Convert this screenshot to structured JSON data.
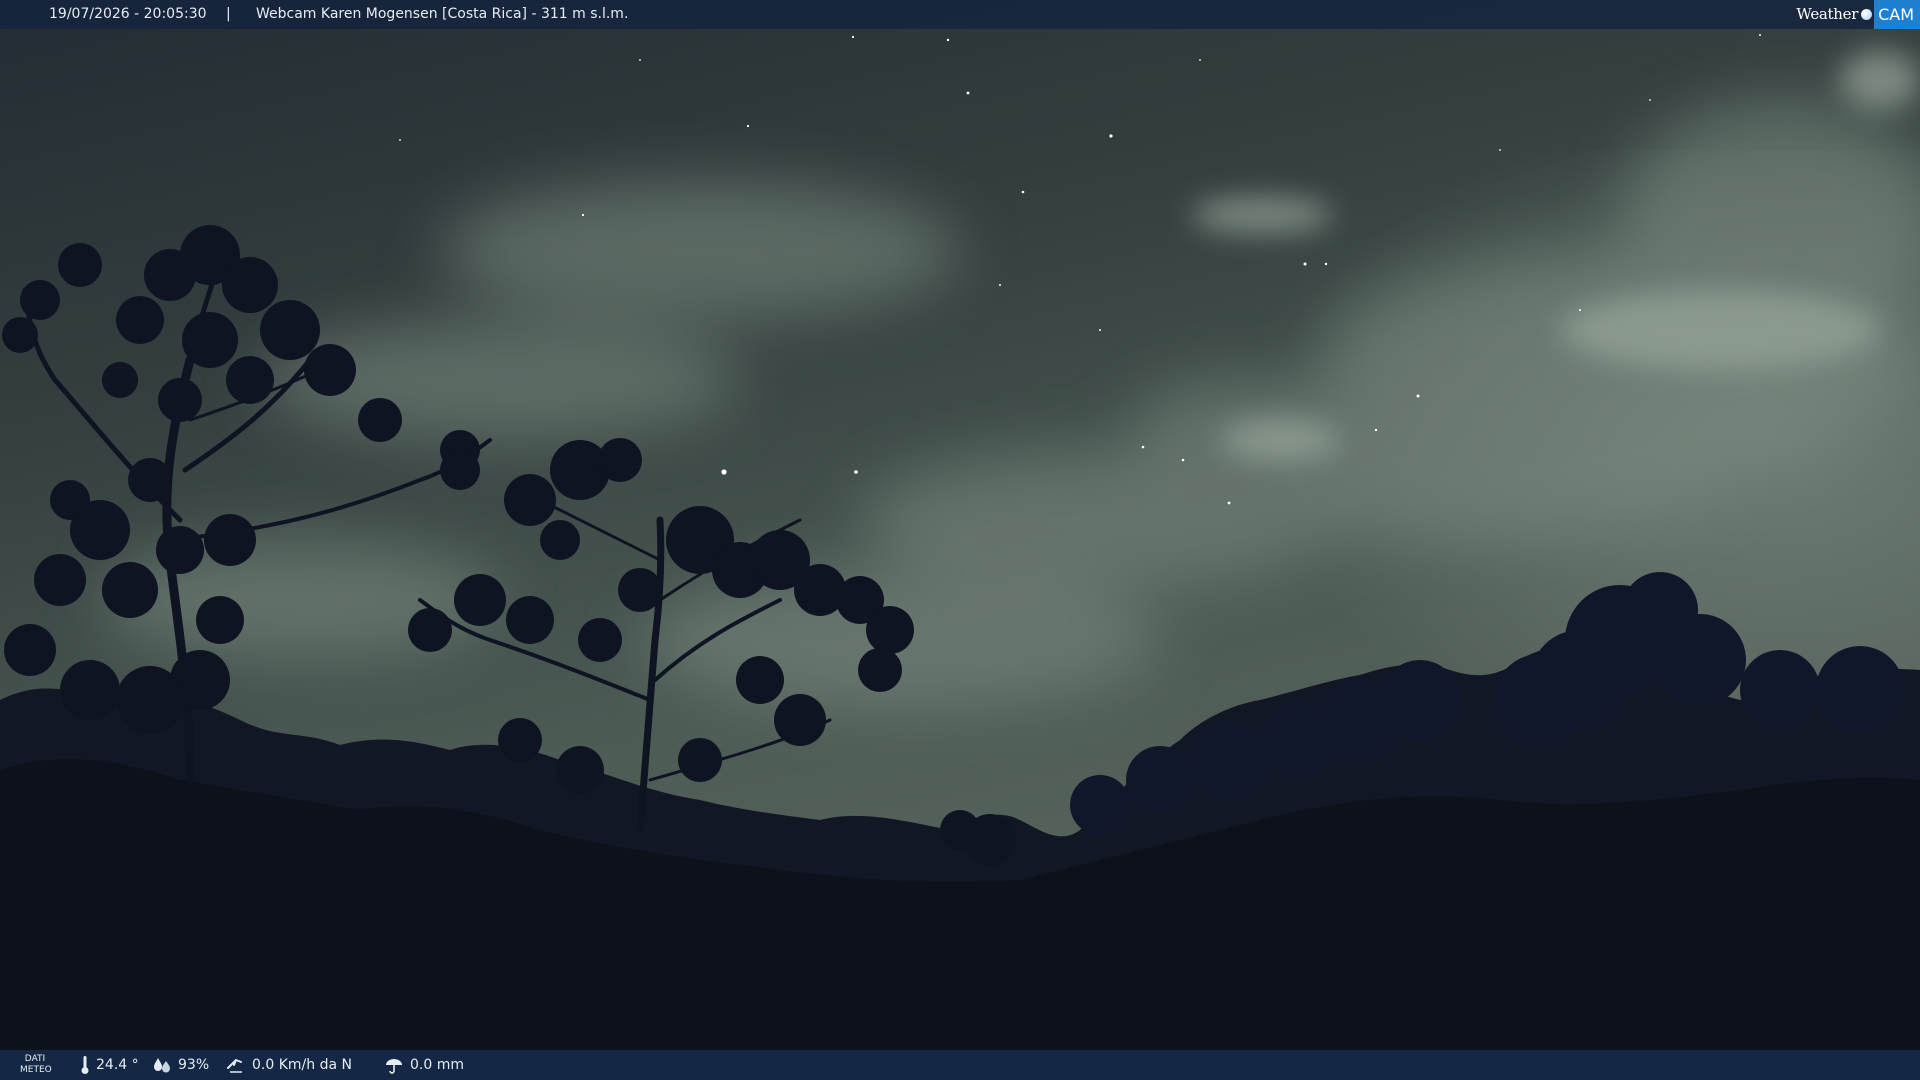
{
  "header": {
    "datetime": "19/07/2026 - 20:05:30",
    "separator": "|",
    "title": "Webcam Karen Mogensen [Costa Rica] - 311 m s.l.m.",
    "logo": {
      "left_text": "Weather",
      "right_text": "CAM",
      "dot_icon": "globe-dot-icon"
    }
  },
  "footer": {
    "label_line1": "DATI",
    "label_line2": "METEO",
    "temperature": "24.4 °",
    "humidity": "93%",
    "wind": "0.0 Km/h da N",
    "rain": "0.0 mm",
    "icons": {
      "temperature": "thermometer-icon",
      "humidity": "humidity-drops-icon",
      "wind": "wind-icon",
      "rain": "rain-gauge-icon"
    }
  },
  "colors": {
    "bar_background": "#14233e",
    "logo_accent": "#1f7fd0",
    "sky": "#4b5a55",
    "foliage": "#0c111c"
  }
}
